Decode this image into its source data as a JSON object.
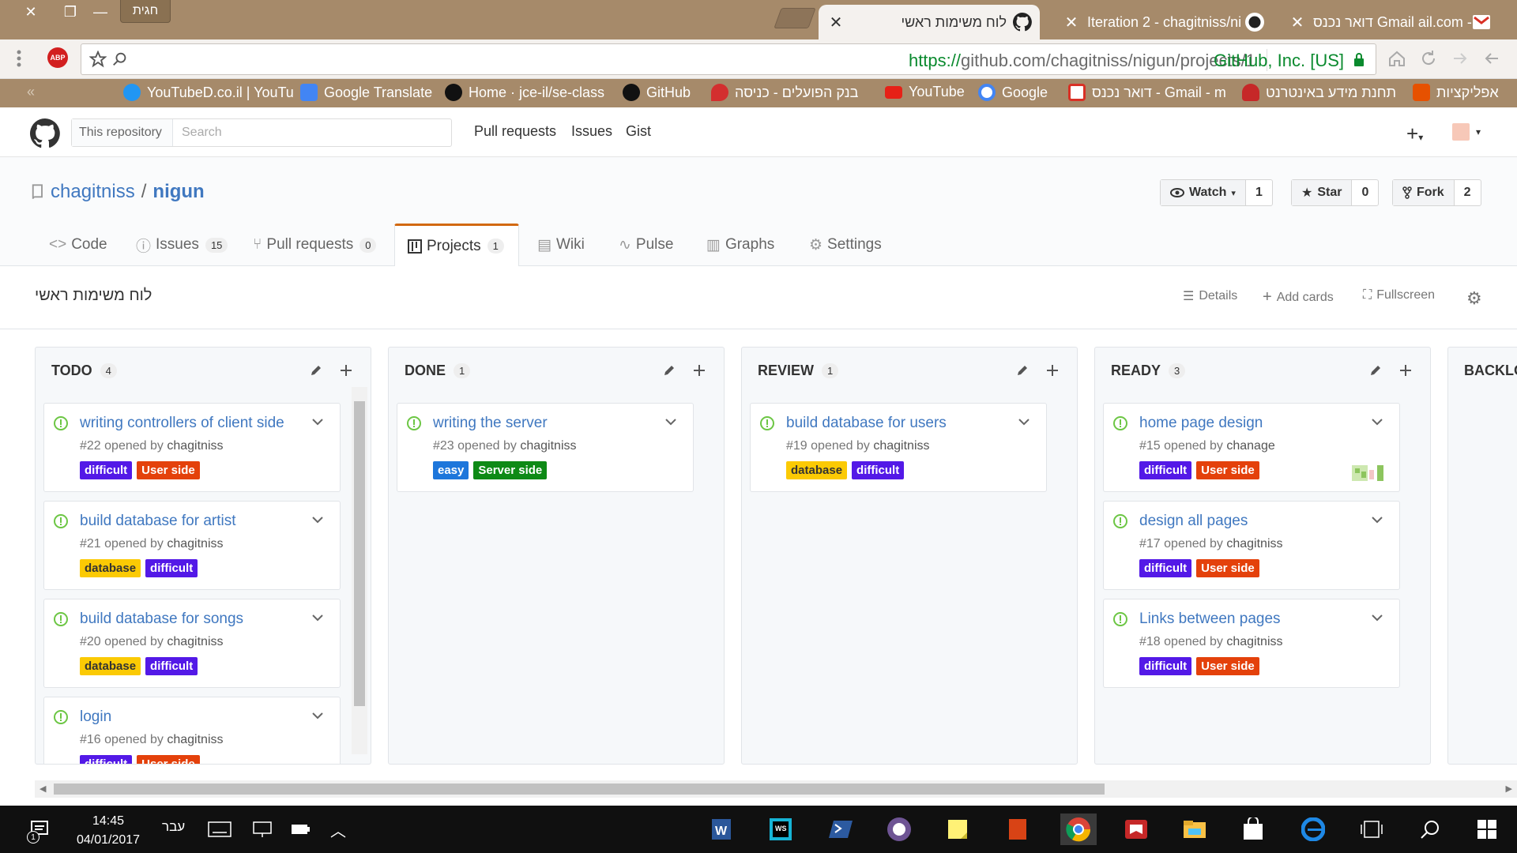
{
  "browser": {
    "profile_name": "חגית",
    "tabs": [
      {
        "title": "לוח משימות ראשי",
        "icon": "github-icon",
        "active": true
      },
      {
        "title": "Iteration 2 - chagitniss/ni",
        "icon": "github-icon",
        "active": false
      },
      {
        "title": "דואר נכנס Gmail ail.com -",
        "icon": "gmail-icon",
        "active": false
      }
    ],
    "url": {
      "scheme": "https://",
      "host_path": "github.com/chagitniss/nigun/projects/1"
    },
    "site_identity": "GitHub, Inc. [US]",
    "extension_label": "ABP",
    "bookmarks": [
      {
        "label": "אפליקציות",
        "icon": "apps-icon",
        "color": "#e65100"
      },
      {
        "label": "תחנת מידע באינטרנט",
        "icon": "bookmark-icon",
        "color": "#c62828"
      },
      {
        "label": "דואר נכנס - Gmail - m",
        "icon": "gmail-icon",
        "color": "#d93025"
      },
      {
        "label": "Google",
        "icon": "google-icon",
        "color": "#4285f4"
      },
      {
        "label": "YouTube",
        "icon": "youtube-icon",
        "color": "#e62117"
      },
      {
        "label": "בנק הפועלים - כניסה",
        "icon": "bank-icon",
        "color": "#d32f2f"
      },
      {
        "label": "GitHub",
        "icon": "github-icon",
        "color": "#111"
      },
      {
        "label": "Home · jce-il/se-class",
        "icon": "github-icon",
        "color": "#111"
      },
      {
        "label": "Google Translate",
        "icon": "translate-icon",
        "color": "#4285f4"
      },
      {
        "label": "YouTubeD.co.il | YouTu",
        "icon": "youtubed-icon",
        "color": "#2196f3"
      }
    ]
  },
  "github": {
    "search_scope": "This repository",
    "search_placeholder": "Search",
    "nav": [
      "Pull requests",
      "Issues",
      "Gist"
    ],
    "repo_owner": "chagitniss",
    "repo_name": "nigun",
    "watch": {
      "label": "Watch",
      "count": "1"
    },
    "star": {
      "label": "Star",
      "count": "0"
    },
    "fork": {
      "label": "Fork",
      "count": "2"
    },
    "repo_tabs": [
      {
        "label": "Code",
        "count": ""
      },
      {
        "label": "Issues",
        "count": "15"
      },
      {
        "label": "Pull requests",
        "count": "0"
      },
      {
        "label": "Projects",
        "count": "1"
      },
      {
        "label": "Wiki",
        "count": ""
      },
      {
        "label": "Pulse",
        "count": ""
      },
      {
        "label": "Graphs",
        "count": ""
      },
      {
        "label": "Settings",
        "count": ""
      }
    ]
  },
  "project": {
    "name": "לוח משימות ראשי",
    "tools": {
      "details": "Details",
      "add_cards": "Add cards",
      "fullscreen": "Fullscreen"
    }
  },
  "label_colors": {
    "difficult": "#5319e7",
    "User side": "#e4410b",
    "database": "#fbca04",
    "easy": "#1d76db",
    "Server side": "#0e8a16"
  },
  "columns": [
    {
      "name": "TODO",
      "count": "4",
      "cards": [
        {
          "title": "writing controllers of client side",
          "number": "#22",
          "opened_by": "opened by",
          "author": "chagitniss",
          "labels": [
            "difficult",
            "User side"
          ]
        },
        {
          "title": "build database for artist",
          "number": "#21",
          "opened_by": "opened by",
          "author": "chagitniss",
          "labels": [
            "database",
            "difficult"
          ]
        },
        {
          "title": "build database for songs",
          "number": "#20",
          "opened_by": "opened by",
          "author": "chagitniss",
          "labels": [
            "database",
            "difficult"
          ]
        },
        {
          "title": "login",
          "number": "#16",
          "opened_by": "opened by",
          "author": "chagitniss",
          "labels": [
            "difficult",
            "User side"
          ]
        }
      ]
    },
    {
      "name": "DONE",
      "count": "1",
      "cards": [
        {
          "title": "writing the server",
          "number": "#23",
          "opened_by": "opened by",
          "author": "chagitniss",
          "labels": [
            "easy",
            "Server side"
          ]
        }
      ]
    },
    {
      "name": "REVIEW",
      "count": "1",
      "cards": [
        {
          "title": "build database for users",
          "number": "#19",
          "opened_by": "opened by",
          "author": "chagitniss",
          "labels": [
            "database",
            "difficult"
          ]
        }
      ]
    },
    {
      "name": "READY",
      "count": "3",
      "cards": [
        {
          "title": "home page design",
          "number": "#15",
          "opened_by": "opened by",
          "author": "chanage",
          "labels": [
            "difficult",
            "User side"
          ],
          "assignee_avatar": true
        },
        {
          "title": "design all pages",
          "number": "#17",
          "opened_by": "opened by",
          "author": "chagitniss",
          "labels": [
            "difficult",
            "User side"
          ]
        },
        {
          "title": "Links between pages",
          "number": "#18",
          "opened_by": "opened by",
          "author": "chagitniss",
          "labels": [
            "difficult",
            "User side"
          ]
        }
      ]
    },
    {
      "name": "BACKLO",
      "count": "",
      "cards": []
    }
  ],
  "taskbar": {
    "time": "14:45",
    "date": "04/01/2017",
    "language": "עבר",
    "notification_count": "1",
    "apps": [
      "word-icon",
      "webstorm-icon",
      "powershell-icon",
      "github-desktop-icon",
      "sticky-notes-icon",
      "app-icon",
      "chrome-icon",
      "reader-icon",
      "file-explorer-icon",
      "store-icon",
      "edge-icon",
      "tablet-mode-icon",
      "search-icon",
      "start-icon"
    ]
  }
}
